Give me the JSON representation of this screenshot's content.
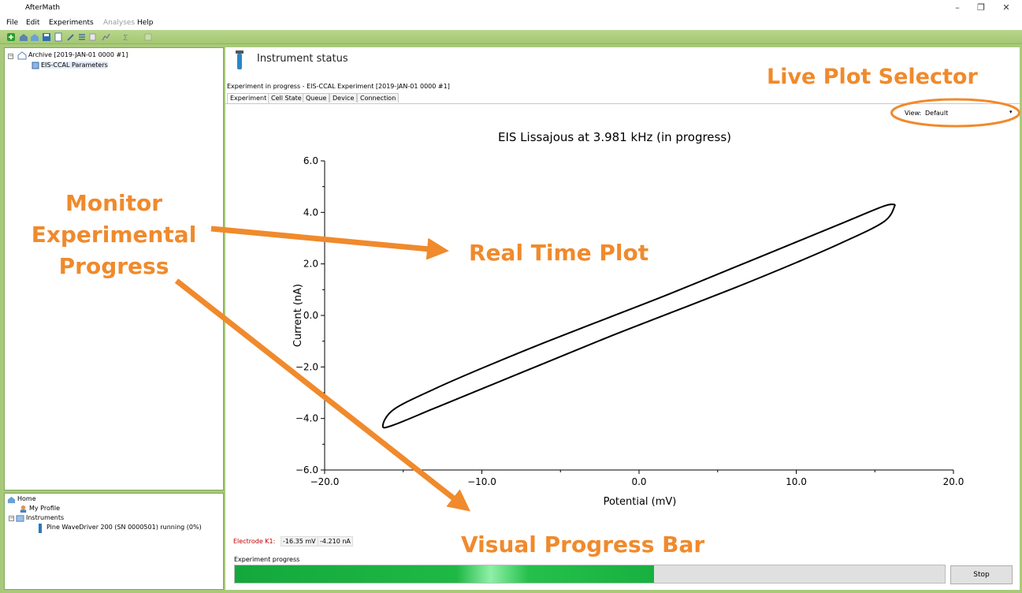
{
  "window": {
    "title": "AfterMath",
    "minimize": "–",
    "restore": "❐",
    "close": "✕"
  },
  "menu": {
    "items": [
      {
        "label": "File",
        "disabled": false
      },
      {
        "label": "Edit",
        "disabled": false
      },
      {
        "label": "Experiments",
        "disabled": false
      },
      {
        "label": "Analyses",
        "disabled": true
      },
      {
        "label": "Help",
        "disabled": false
      }
    ]
  },
  "archive_tree": {
    "root": "Archive [2019-JAN-01 0000 #1]",
    "child": "EIS-CCAL Parameters"
  },
  "home_tree": {
    "home": "Home",
    "profile": "My Profile",
    "instruments": "Instruments",
    "instrument": "Pine WaveDriver 200 (SN 0000501) running (0%)"
  },
  "main": {
    "heading": "Instrument status",
    "experiment_line": "Experiment in progress - EIS-CCAL Experiment [2019-JAN-01 0000 #1]",
    "tabs": [
      "Experiment",
      "Cell State",
      "Queue",
      "Device",
      "Connection"
    ],
    "active_tab": "Experiment",
    "view_label": "View:",
    "view_value": "Default",
    "electrode_label": "Electrode K1:",
    "potential_reading": "-16.35 mV",
    "current_reading": "-4.210 nA",
    "progress_label": "Experiment progress",
    "progress_fraction": 0.59,
    "stop_label": "Stop"
  },
  "callouts": {
    "live_plot": "Live Plot Selector",
    "monitor_1": "Monitor",
    "monitor_2": "Experimental",
    "monitor_3": "Progress",
    "real_time": "Real Time Plot",
    "progress_bar": "Visual Progress Bar",
    "color": "#f08a2c"
  },
  "chart_data": {
    "type": "line",
    "title": "EIS Lissajous at 3.981 kHz (in progress)",
    "xlabel": "Potential (mV)",
    "ylabel": "Current (nA)",
    "xlim": [
      -20,
      20
    ],
    "ylim": [
      -6,
      6
    ],
    "xticks": [
      "−20.0",
      "−10.0",
      "0.0",
      "10.0",
      "20.0"
    ],
    "yticks": [
      "−6.0",
      "−4.0",
      "−2.0",
      "0.0",
      "2.0",
      "4.0",
      "6.0"
    ],
    "grid": false,
    "series": [
      {
        "color": "#000000",
        "x": [
          16.3,
          15.6,
          13.0,
          10.0,
          6.0,
          2.0,
          -2.0,
          -6.0,
          -10.0,
          -13.0,
          -15.6,
          -16.3,
          -15.6,
          -13.0,
          -10.0,
          -6.0,
          -2.0,
          2.0,
          6.0,
          10.0,
          13.0,
          15.6,
          16.3
        ],
        "y": [
          4.3,
          4.25,
          3.6,
          2.85,
          1.85,
          0.85,
          -0.1,
          -1.05,
          -2.05,
          -2.85,
          -3.65,
          -4.3,
          -4.25,
          -3.6,
          -2.85,
          -1.85,
          -0.85,
          0.1,
          1.05,
          2.05,
          2.85,
          3.65,
          4.3
        ]
      }
    ]
  }
}
